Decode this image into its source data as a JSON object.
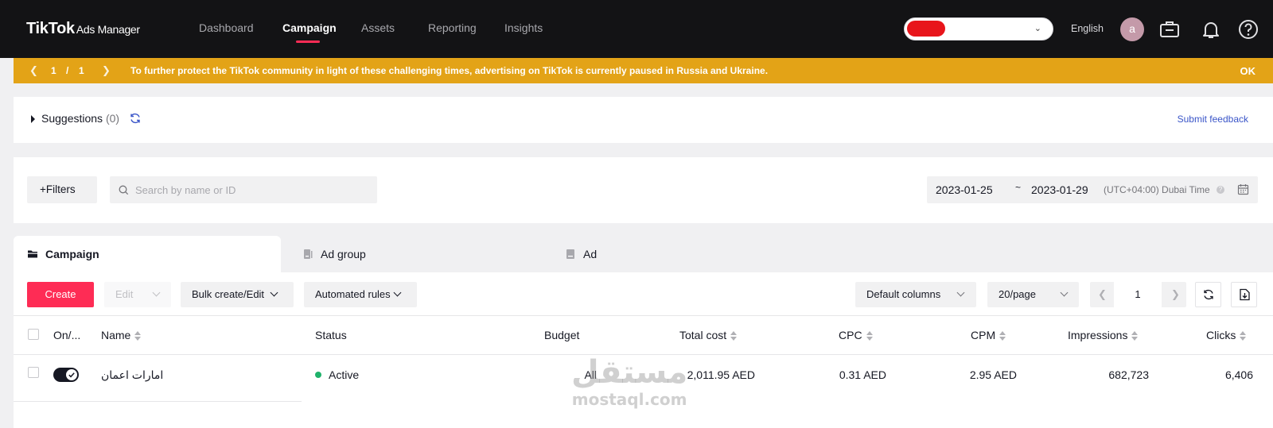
{
  "app": {
    "logo": "TikTok",
    "logo_sub": "Ads Manager"
  },
  "nav": {
    "items": [
      {
        "label": "Dashboard"
      },
      {
        "label": "Campaign"
      },
      {
        "label": "Assets"
      },
      {
        "label": "Reporting"
      },
      {
        "label": "Insights"
      }
    ],
    "active": "Campaign",
    "language": "English",
    "avatar_initial": "a"
  },
  "banner": {
    "page_current": "1",
    "page_sep": "/",
    "page_total": "1",
    "message": "To further protect the TikTok community in light of these challenging times, advertising on TikTok is currently paused in Russia and Ukraine.",
    "ok": "OK",
    "color": "#e3a317"
  },
  "suggestions": {
    "title": "Suggestions",
    "count": "(0)",
    "feedback": "Submit feedback"
  },
  "filters": {
    "filters_label": "Filters",
    "search_placeholder": "Search by name or ID",
    "date_start": "2023-01-25",
    "date_sep": "~",
    "date_end": "2023-01-29",
    "timezone": "(UTC+04:00) Dubai Time"
  },
  "tabs": [
    {
      "label": "Campaign",
      "icon": "folder-icon"
    },
    {
      "label": "Ad group",
      "icon": "adgroup-icon"
    },
    {
      "label": "Ad",
      "icon": "ad-icon"
    }
  ],
  "toolbar": {
    "create": "Create",
    "edit": "Edit",
    "bulk": "Bulk create/Edit",
    "rules": "Automated rules",
    "columns": "Default columns",
    "per_page": "20/page",
    "page": "1"
  },
  "table": {
    "headers": {
      "onoff": "On/...",
      "name": "Name",
      "status": "Status",
      "budget": "Budget",
      "total_cost": "Total cost",
      "cpc": "CPC",
      "cpm": "CPM",
      "impressions": "Impressions",
      "clicks": "Clicks"
    },
    "rows": [
      {
        "on": true,
        "name": "امارات اعمان",
        "status": "Active",
        "budget": "All",
        "total_cost": "2,011.95 AED",
        "cpc": "0.31 AED",
        "cpm": "2.95 AED",
        "impressions": "682,723",
        "clicks": "6,406"
      }
    ]
  },
  "watermark": {
    "arabic": "مستقل",
    "latin": "mostaql.com"
  },
  "colors": {
    "accent": "#fe2c55",
    "status_active": "#20b26b",
    "link": "#3a55c8"
  }
}
